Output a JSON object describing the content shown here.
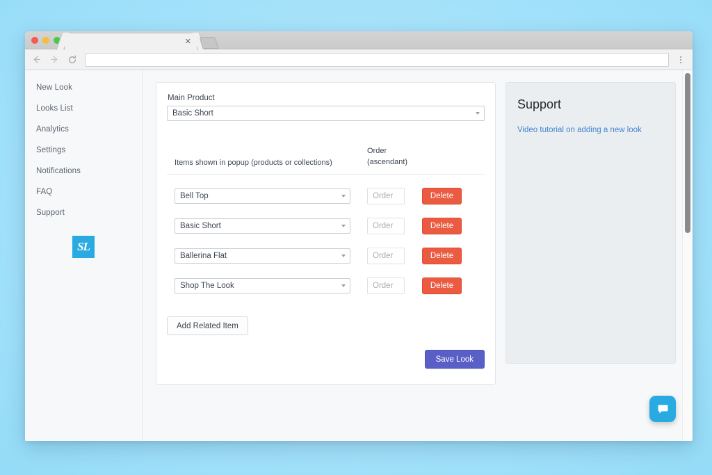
{
  "browser": {
    "tab_title": "",
    "tab_close_icon": "close-icon",
    "url_value": "",
    "url_placeholder": "",
    "back_icon": "back-arrow-icon",
    "forward_icon": "forward-arrow-icon",
    "reload_icon": "reload-icon",
    "menu_icon": "kebab-menu-icon",
    "new_tab_icon": "new-tab-icon"
  },
  "sidebar": {
    "items": [
      {
        "label": "New Look"
      },
      {
        "label": "Looks List"
      },
      {
        "label": "Analytics"
      },
      {
        "label": "Settings"
      },
      {
        "label": "Notifications"
      },
      {
        "label": "FAQ"
      },
      {
        "label": "Support"
      }
    ],
    "logo_text": "SL",
    "logo_color": "#29abe2"
  },
  "main": {
    "main_product_label": "Main Product",
    "main_product_value": "Basic Short",
    "items_column_header": "Items shown in popup (products or collections)",
    "order_column_header_line1": "Order",
    "order_column_header_line2": "(ascendant)",
    "rows": [
      {
        "product": "Bell Top",
        "order_value": "",
        "order_placeholder": "Order",
        "delete_label": "Delete"
      },
      {
        "product": "Basic Short",
        "order_value": "",
        "order_placeholder": "Order",
        "delete_label": "Delete"
      },
      {
        "product": "Ballerina Flat",
        "order_value": "",
        "order_placeholder": "Order",
        "delete_label": "Delete"
      },
      {
        "product": "Shop The Look",
        "order_value": "",
        "order_placeholder": "Order",
        "delete_label": "Delete"
      }
    ],
    "add_related_label": "Add Related Item",
    "save_label": "Save Look",
    "delete_color": "#eb5b41",
    "save_color": "#5a5fc7"
  },
  "support": {
    "title": "Support",
    "link_text": "Video tutorial on adding a new look",
    "link_color": "#3f84d2"
  },
  "chat": {
    "icon": "chat-bubble-icon",
    "color": "#29abe2"
  }
}
